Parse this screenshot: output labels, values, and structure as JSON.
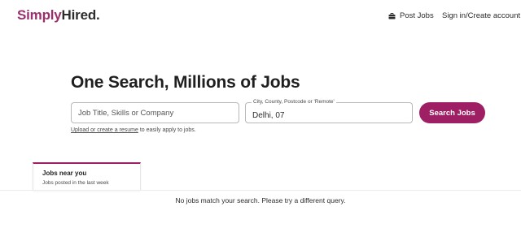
{
  "header": {
    "logo_part1": "Simply",
    "logo_part2": "Hired.",
    "post_jobs": "Post Jobs",
    "sign_in": "Sign in/Create account"
  },
  "hero": {
    "title": "One Search, Millions of Jobs"
  },
  "search": {
    "what_placeholder": "Job Title, Skills or Company",
    "where_label": "City, County, Postcode or 'Remote'",
    "where_value": "Delhi, 07",
    "button_label": "Search Jobs"
  },
  "resume": {
    "link_text": "Upload or create a resume",
    "suffix": " to easily apply to jobs."
  },
  "tab": {
    "title": "Jobs near you",
    "subtitle": "Jobs posted in the last week"
  },
  "results": {
    "empty_message": "No jobs match your search. Please try a different query."
  },
  "colors": {
    "brand": "#9e1f63",
    "logo_accent": "#9b2f6e"
  },
  "icons": {
    "post_jobs": "briefcase-icon"
  }
}
